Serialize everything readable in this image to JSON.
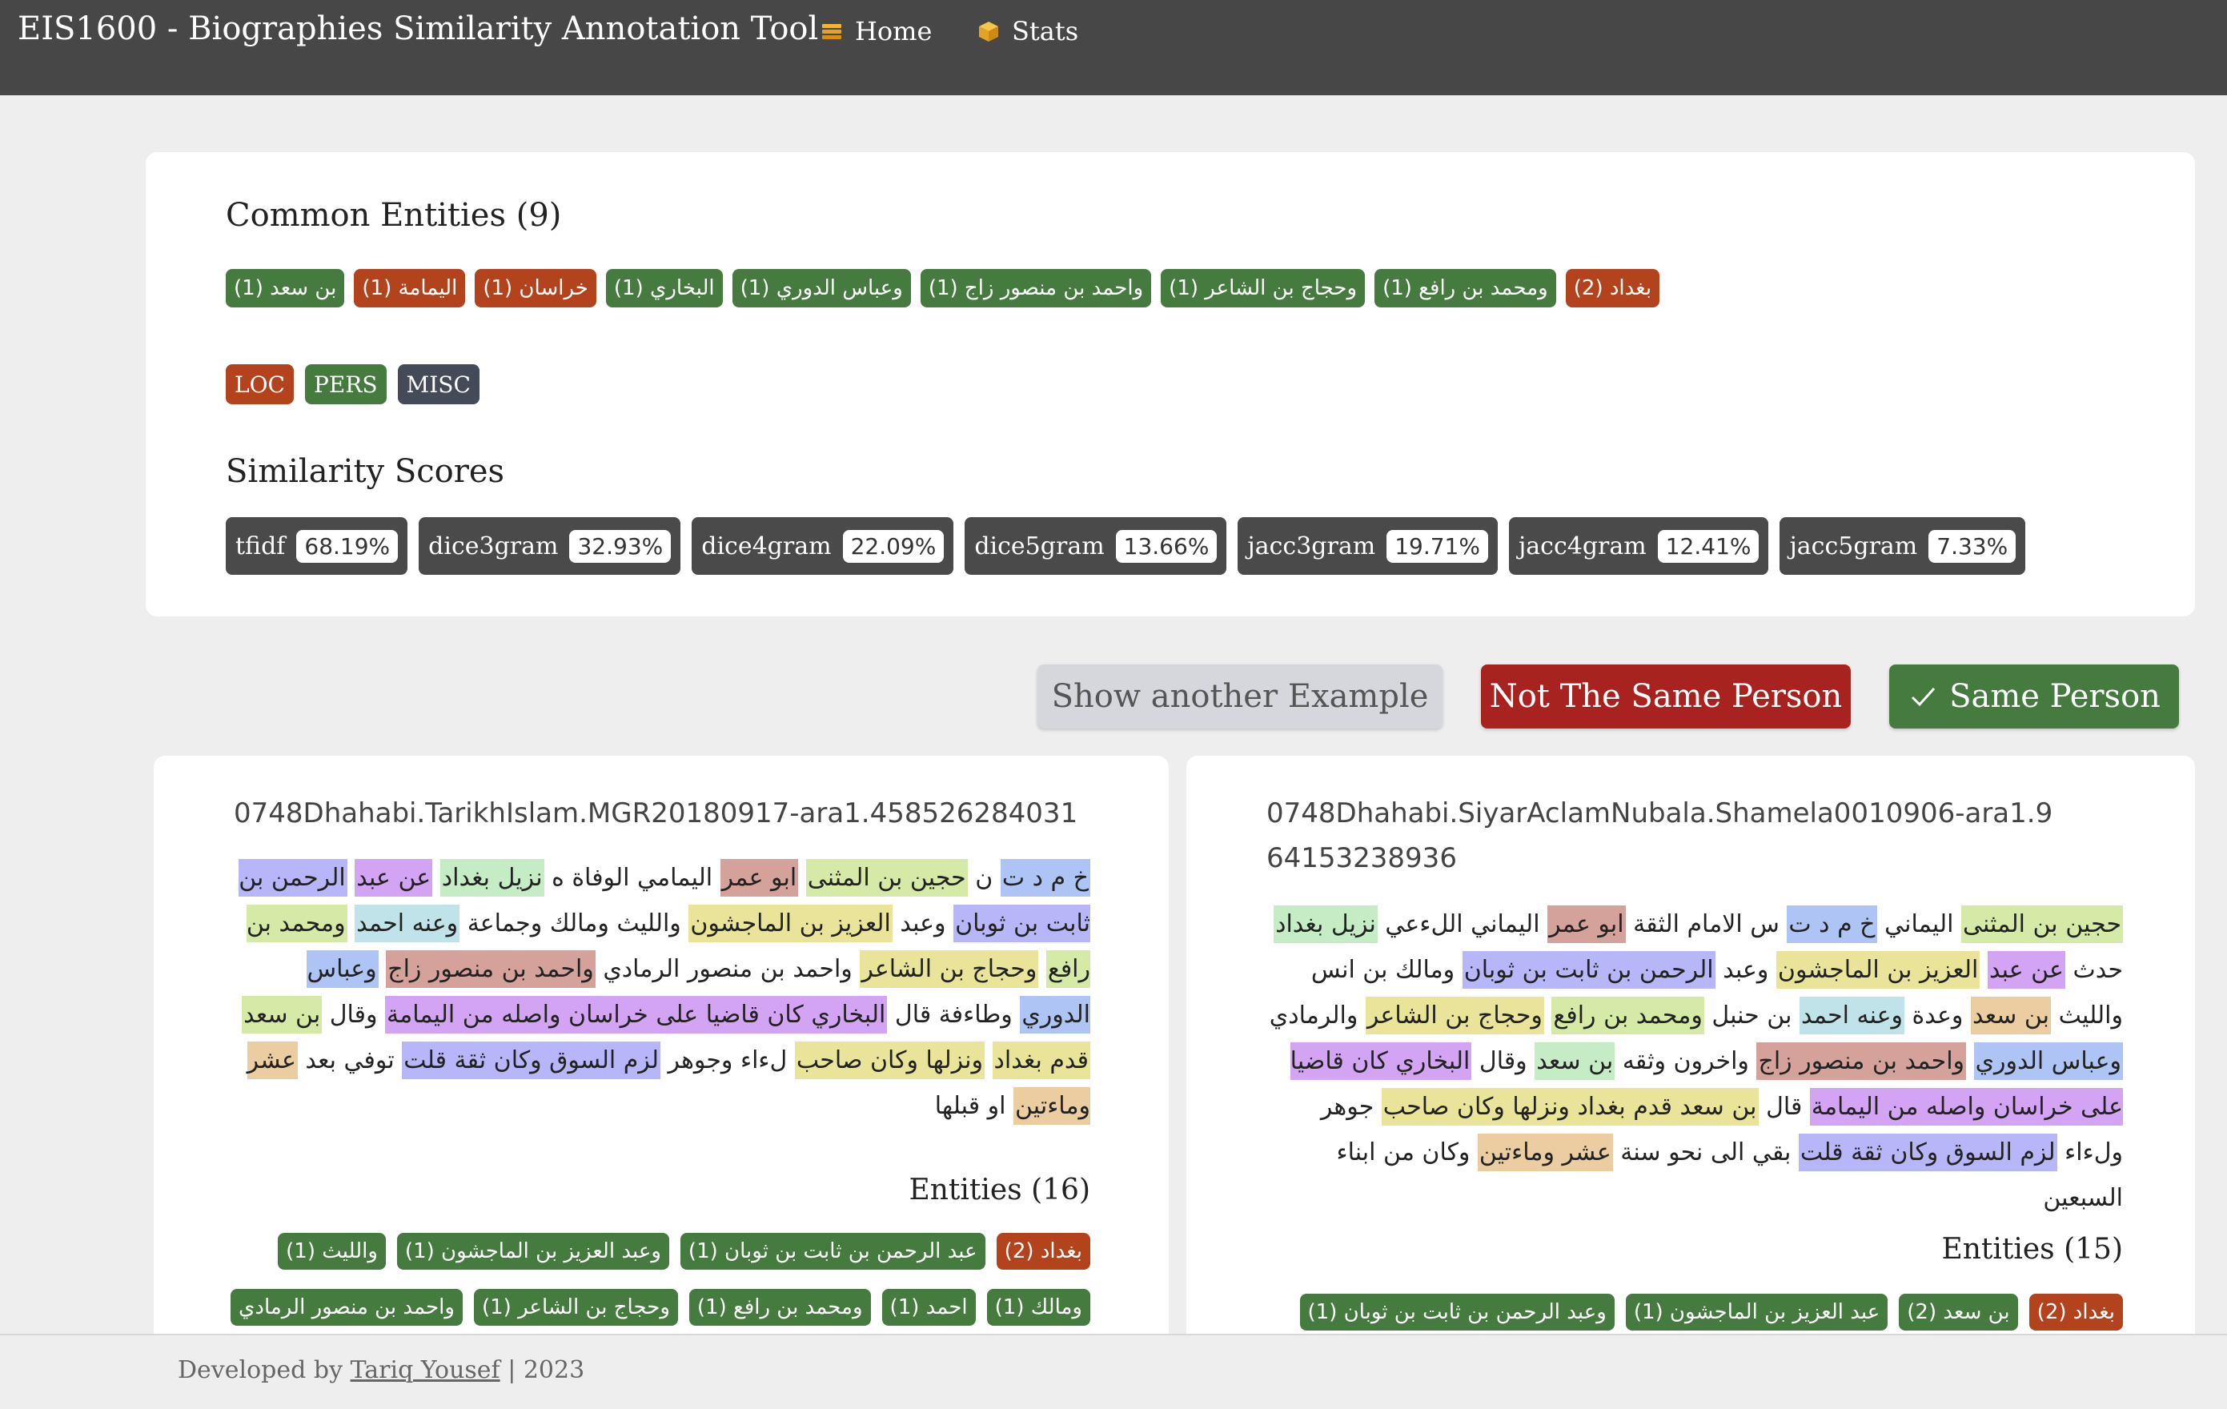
{
  "navbar": {
    "brand": "EIS1600 - Biographies Similarity Annotation Tool",
    "links": [
      {
        "label": "Home",
        "icon": "stack-icon"
      },
      {
        "label": "Stats",
        "icon": "box-icon"
      }
    ]
  },
  "common": {
    "title": "Common Entities (9)",
    "entities": [
      {
        "text": "بغداد (2)",
        "type": "LOC"
      },
      {
        "text": "ومحمد بن رافع (1)",
        "type": "PERS"
      },
      {
        "text": "وحجاج بن الشاعر (1)",
        "type": "PERS"
      },
      {
        "text": "واحمد بن منصور زاج (1)",
        "type": "PERS"
      },
      {
        "text": "وعباس الدوري (1)",
        "type": "PERS"
      },
      {
        "text": "البخاري (1)",
        "type": "PERS"
      },
      {
        "text": "خراسان (1)",
        "type": "LOC"
      },
      {
        "text": "اليمامة (1)",
        "type": "LOC"
      },
      {
        "text": "بن سعد (1)",
        "type": "PERS"
      }
    ],
    "legend": [
      "LOC",
      "PERS",
      "MISC"
    ]
  },
  "similarity": {
    "title": "Similarity Scores",
    "scores": [
      {
        "name": "tfidf",
        "value": "68.19%"
      },
      {
        "name": "dice3gram",
        "value": "32.93%"
      },
      {
        "name": "dice4gram",
        "value": "22.09%"
      },
      {
        "name": "dice5gram",
        "value": "13.66%"
      },
      {
        "name": "jacc3gram",
        "value": "19.71%"
      },
      {
        "name": "jacc4gram",
        "value": "12.41%"
      },
      {
        "name": "jacc5gram",
        "value": "7.33%"
      }
    ]
  },
  "actions": {
    "another": "Show another Example",
    "not_same": "Not The Same Person",
    "same": "Same Person"
  },
  "left_bio": {
    "title": "0748Dhahabi.TarikhIslam.MGR20180917-ara1.458526284031",
    "text_segments": [
      {
        "t": "خ م د ت",
        "c": "c9"
      },
      {
        "t": " ن ",
        "c": ""
      },
      {
        "t": "حجين بن المثنى",
        "c": "c2"
      },
      {
        "t": " ",
        "c": ""
      },
      {
        "t": "ابو عمر",
        "c": "c3"
      },
      {
        "t": " اليمامي الوفاة ه ",
        "c": ""
      },
      {
        "t": "نزيل بغداد",
        "c": "c8"
      },
      {
        "t": " ",
        "c": ""
      },
      {
        "t": "عن عبد",
        "c": "c4"
      },
      {
        "t": " ",
        "c": ""
      },
      {
        "t": "الرحمن بن ثابت بن ثوبان",
        "c": "c1"
      },
      {
        "t": " وعبد ",
        "c": ""
      },
      {
        "t": "العزيز بن الماجشون",
        "c": "c5"
      },
      {
        "t": " والليث ومالك وجماعة ",
        "c": ""
      },
      {
        "t": "وعنه احمد",
        "c": "c6"
      },
      {
        "t": " ",
        "c": ""
      },
      {
        "t": "ومحمد بن رافع",
        "c": "c2"
      },
      {
        "t": " ",
        "c": ""
      },
      {
        "t": "وحجاج بن الشاعر",
        "c": "c5"
      },
      {
        "t": " واحمد بن منصور الرمادي ",
        "c": ""
      },
      {
        "t": "واحمد بن منصور زاج",
        "c": "c3"
      },
      {
        "t": " ",
        "c": ""
      },
      {
        "t": "وعباس الدوري",
        "c": "c9"
      },
      {
        "t": " وطاءفة قال ",
        "c": ""
      },
      {
        "t": "البخاري كان قاضيا على خراسان واصله من اليمامة",
        "c": "c4"
      },
      {
        "t": " وقال ",
        "c": ""
      },
      {
        "t": "بن سعد",
        "c": "c2"
      },
      {
        "t": " ",
        "c": ""
      },
      {
        "t": "قدم بغداد",
        "c": "c5"
      },
      {
        "t": " ",
        "c": ""
      },
      {
        "t": "ونزلها وكان صاحب",
        "c": "c5"
      },
      {
        "t": " لءاء وجوهر ",
        "c": ""
      },
      {
        "t": "لزم السوق وكان ثقة قلت",
        "c": "c1"
      },
      {
        "t": " توفي بعد ",
        "c": ""
      },
      {
        "t": "عشر وماءتين",
        "c": "c7"
      },
      {
        "t": " او قبلها",
        "c": ""
      }
    ],
    "entities_title": "Entities (16)",
    "entities": [
      {
        "text": "بغداد (2)",
        "type": "LOC"
      },
      {
        "text": "عبد الرحمن بن ثابت بن ثوبان (1)",
        "type": "PERS"
      },
      {
        "text": "وعبد العزيز بن الماجشون (1)",
        "type": "PERS"
      },
      {
        "text": "والليث (1)",
        "type": "PERS"
      },
      {
        "text": "ومالك (1)",
        "type": "PERS"
      },
      {
        "text": "احمد (1)",
        "type": "PERS"
      },
      {
        "text": "ومحمد بن رافع (1)",
        "type": "PERS"
      },
      {
        "text": "وحجاج بن الشاعر (1)",
        "type": "PERS"
      },
      {
        "text": "واحمد بن منصور الرمادي",
        "type": "PERS"
      }
    ]
  },
  "right_bio": {
    "title": "0748Dhahabi.SiyarAclamNubala.Shamela0010906-ara1.964153238936",
    "text_segments": [
      {
        "t": "حجين بن المثنى",
        "c": "c2"
      },
      {
        "t": " اليماني ",
        "c": ""
      },
      {
        "t": "خ م د ت",
        "c": "c9"
      },
      {
        "t": " س الامام الثقة ",
        "c": ""
      },
      {
        "t": "ابو عمر",
        "c": "c3"
      },
      {
        "t": " اليماني اللءعي ",
        "c": ""
      },
      {
        "t": "نزيل بغداد",
        "c": "c8"
      },
      {
        "t": " حدث ",
        "c": ""
      },
      {
        "t": "عن عبد",
        "c": "c4"
      },
      {
        "t": " ",
        "c": ""
      },
      {
        "t": "العزيز بن الماجشون",
        "c": "c5"
      },
      {
        "t": " وعبد ",
        "c": ""
      },
      {
        "t": "الرحمن بن ثابت بن ثوبان",
        "c": "c1"
      },
      {
        "t": " ومالك بن انس والليث ",
        "c": ""
      },
      {
        "t": "بن سعد",
        "c": "c7"
      },
      {
        "t": " وعدة ",
        "c": ""
      },
      {
        "t": "وعنه احمد",
        "c": "c6"
      },
      {
        "t": " بن حنبل ",
        "c": ""
      },
      {
        "t": "ومحمد بن رافع",
        "c": "c2"
      },
      {
        "t": " ",
        "c": ""
      },
      {
        "t": "وحجاج بن الشاعر",
        "c": "c5"
      },
      {
        "t": " والرمادي ",
        "c": ""
      },
      {
        "t": "وعباس الدوري",
        "c": "c9"
      },
      {
        "t": " ",
        "c": ""
      },
      {
        "t": "واحمد بن منصور زاج",
        "c": "c3"
      },
      {
        "t": " واخرون وثقه ",
        "c": ""
      },
      {
        "t": "بن سعد",
        "c": "c8"
      },
      {
        "t": " وقال ",
        "c": ""
      },
      {
        "t": "البخاري كان قاضيا على خراسان واصله من اليمامة",
        "c": "c4"
      },
      {
        "t": " قال ",
        "c": ""
      },
      {
        "t": "بن سعد قدم بغداد ونزلها وكان صاحب",
        "c": "c5"
      },
      {
        "t": " جوهر ولءاء ",
        "c": ""
      },
      {
        "t": "لزم السوق وكان ثقة قلت",
        "c": "c1"
      },
      {
        "t": " بقي الى نحو سنة ",
        "c": ""
      },
      {
        "t": "عشر وماءتين",
        "c": "c7"
      },
      {
        "t": " وكان من ابناء السبعين",
        "c": ""
      }
    ],
    "entities_title": "Entities (15)",
    "entities": [
      {
        "text": "بغداد (2)",
        "type": "LOC"
      },
      {
        "text": "بن سعد (2)",
        "type": "PERS"
      },
      {
        "text": "عبد العزيز بن الماجشون (1)",
        "type": "PERS"
      },
      {
        "text": "وعبد الرحمن بن ثابت بن ثوبان (1)",
        "type": "PERS"
      }
    ]
  },
  "footer": {
    "prefix": "Developed by",
    "author": "Tariq Yousef",
    "suffix": "| 2023"
  }
}
